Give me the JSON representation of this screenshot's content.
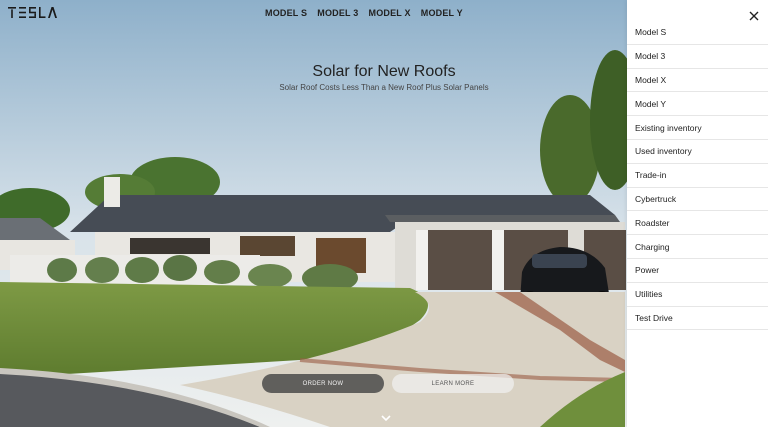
{
  "brand": {
    "logo_text": "TESLA"
  },
  "topnav": {
    "items": [
      "MODEL S",
      "MODEL 3",
      "MODEL X",
      "MODEL Y"
    ]
  },
  "hero": {
    "title": "Solar for New Roofs",
    "subtitle": "Solar Roof Costs Less Than a New Roof Plus Solar Panels",
    "order_label": "ORDER NOW",
    "learn_label": "LEARN MORE"
  },
  "menu": {
    "items": [
      "Model S",
      "Model 3",
      "Model X",
      "Model Y",
      "Existing inventory",
      "Used inventory",
      "Trade-in",
      "Cybertruck",
      "Roadster",
      "Charging",
      "Power",
      "Utilities",
      "Test Drive"
    ]
  },
  "icons": {
    "close": "close-icon",
    "scroll": "chevron-down-icon",
    "logo": "tesla-logo"
  },
  "colors": {
    "sky_top": "#8fb2cc",
    "grass": "#6d8d3a",
    "roof": "#4b5058",
    "panel_bg": "#ffffff"
  }
}
